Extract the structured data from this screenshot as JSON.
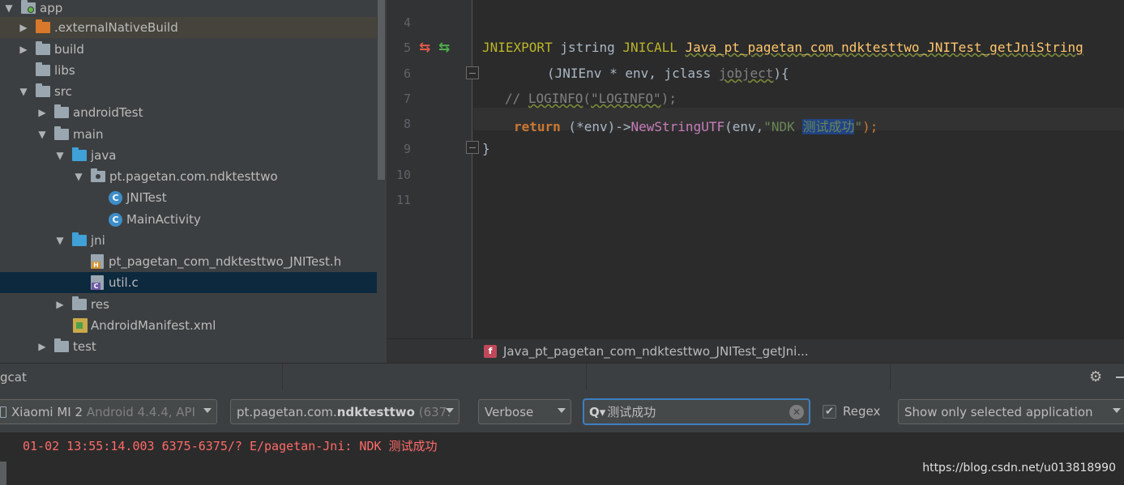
{
  "project_tree": {
    "items": [
      {
        "label": "app",
        "icon": "folder-gray",
        "expanded": true
      },
      {
        "label": ".externalNativeBuild",
        "icon": "folder-orange",
        "expanded": false
      },
      {
        "label": "build",
        "icon": "folder-gray",
        "expanded": false
      },
      {
        "label": "libs",
        "icon": "folder-gray"
      },
      {
        "label": "src",
        "icon": "folder-gray",
        "expanded": true
      },
      {
        "label": "androidTest",
        "icon": "folder-gray",
        "expanded": false
      },
      {
        "label": "main",
        "icon": "folder-gray",
        "expanded": true
      },
      {
        "label": "java",
        "icon": "folder-blue",
        "expanded": true
      },
      {
        "label": "pt.pagetan.com.ndktesttwo",
        "icon": "package",
        "expanded": true
      },
      {
        "label": "JNITest",
        "icon": "class",
        "badge": "C"
      },
      {
        "label": "MainActivity",
        "icon": "class",
        "badge": "C"
      },
      {
        "label": "jni",
        "icon": "folder-blue",
        "expanded": true
      },
      {
        "label": "pt_pagetan_com_ndktesttwo_JNITest.h",
        "icon": "header-file",
        "badge": "H"
      },
      {
        "label": "util.c",
        "icon": "c-file",
        "badge": "C",
        "selected": true
      },
      {
        "label": "res",
        "icon": "folder-gray",
        "expanded": false
      },
      {
        "label": "AndroidManifest.xml",
        "icon": "xml-file"
      },
      {
        "label": "test",
        "icon": "folder-gray",
        "expanded": false
      }
    ]
  },
  "editor": {
    "line_numbers": [
      "4",
      "5",
      "6",
      "7",
      "8",
      "9",
      "10",
      "11"
    ],
    "lines": {
      "l5": {
        "macro1": "JNIEXPORT",
        "type": "jstring",
        "macro2": "JNICALL",
        "fn": "Java_pt_pagetan_com_ndktesttwo_JNITest_getJniString"
      },
      "l6": {
        "open": "(JNIEnv * env, ",
        "type": "jclass",
        "param": "jobject",
        "close": "){"
      },
      "l7": {
        "comment_prefix": "// ",
        "call": "LOGINFO",
        "open": "(",
        "str": "\"LOGINFO\"",
        "close": ");"
      },
      "l8": {
        "kw": "return",
        "mid": " (*env)->",
        "call": "NewStringUTF",
        "open": "(env,",
        "str_pre": "\"NDK ",
        "str_sel": "测试成功",
        "str_post": "\"",
        "close": ");"
      },
      "l9": {
        "text": "}"
      }
    },
    "breadcrumb": {
      "icon_letter": "f",
      "text": "Java_pt_pagetan_com_ndktesttwo_JNITest_getJni..."
    }
  },
  "logcat": {
    "title": "gcat",
    "device": {
      "name": "Xiaomi MI 2",
      "detail": "Android 4.4.4, API"
    },
    "process": {
      "name_prefix": "pt.pagetan.com.",
      "name_bold": "ndktesttwo",
      "pid": "(637:"
    },
    "level": "Verbose",
    "search_value": "测试成功",
    "search_icon": "Q▾",
    "regex_checked": true,
    "regex_label": "Regex",
    "filter": "Show only selected application",
    "log_lines": [
      "01-02 13:55:14.003 6375-6375/? E/pagetan-Jni: NDK 测试成功"
    ],
    "watermark": "https://blog.csdn.net/u013818990"
  },
  "colors": {
    "accent": "#3d7fc1",
    "log_error": "#ff6b68",
    "selection": "#214283"
  }
}
